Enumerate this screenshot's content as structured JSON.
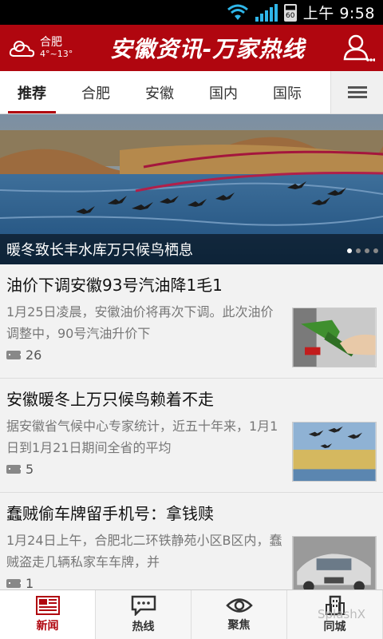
{
  "status_bar": {
    "time": "上午 9:58",
    "battery": "60"
  },
  "header": {
    "weather": {
      "city": "合肥",
      "temp": "4°~13°"
    },
    "title": "安徽资讯-万家热线",
    "colors": {
      "brand": "#b0060f"
    }
  },
  "tabs": [
    {
      "label": "推荐",
      "active": true
    },
    {
      "label": "合肥"
    },
    {
      "label": "安徽"
    },
    {
      "label": "国内"
    },
    {
      "label": "国际"
    }
  ],
  "hero": {
    "caption": "暖冬致长丰水库万只候鸟栖息",
    "slides": 4,
    "active_slide": 1
  },
  "news": [
    {
      "title": "油价下调安徽93号汽油降1毛1",
      "summary": "1月25日凌晨，安徽油价将再次下调。此次油价调整中，90号汽油升价下",
      "comments": "26",
      "thumb": "fuel-pump"
    },
    {
      "title": "安徽暖冬上万只候鸟赖着不走",
      "summary": "据安徽省气候中心专家统计，近五十年来，1月1日到1月21日期间全省的平均",
      "comments": "5",
      "thumb": "birds"
    },
    {
      "title": "蠢贼偷车牌留手机号：拿钱赎",
      "summary": "1月24日上午，合肥北二环铁静苑小区B区内，蠢贼盗走几辆私家车车牌，并",
      "comments": "1",
      "thumb": "car"
    }
  ],
  "bottom_nav": [
    {
      "label": "新闻",
      "icon": "newspaper-icon",
      "active": true
    },
    {
      "label": "热线",
      "icon": "chat-icon"
    },
    {
      "label": "聚焦",
      "icon": "eye-icon"
    },
    {
      "label": "同城",
      "icon": "building-icon"
    }
  ],
  "watermark": "SplashX"
}
